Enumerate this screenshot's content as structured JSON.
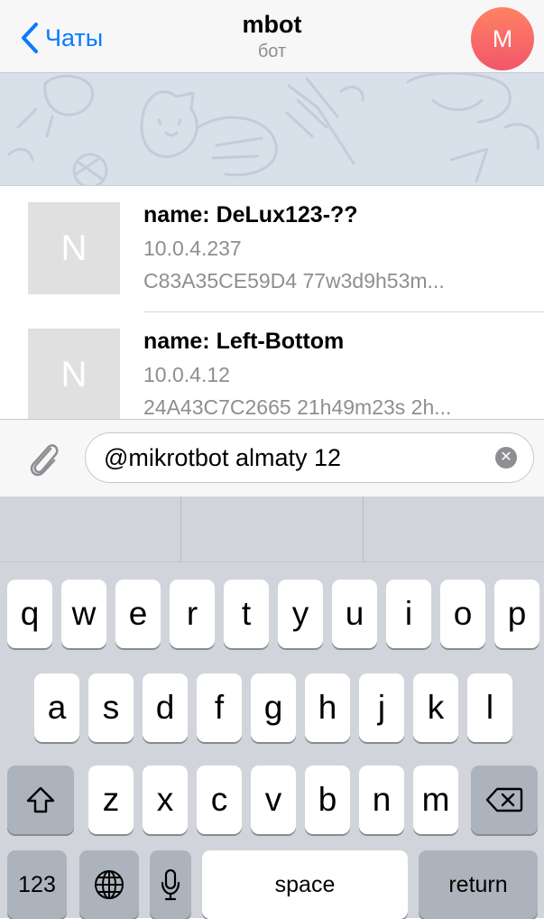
{
  "header": {
    "back_label": "Чаты",
    "title": "mbot",
    "subtitle": "бот",
    "avatar_letter": "M"
  },
  "results": [
    {
      "thumb_letter": "N",
      "title": "name: DeLux123-??",
      "line2": "10.0.4.237",
      "line3": "C83A35CE59D4  77w3d9h53m..."
    },
    {
      "thumb_letter": "N",
      "title": "name: Left-Bottom",
      "line2": "10.0.4.12",
      "line3": "24A43C7C2665 21h49m23s 2h..."
    }
  ],
  "input": {
    "value": "@mikrotbot almaty 12"
  },
  "keyboard": {
    "row1": [
      "q",
      "w",
      "e",
      "r",
      "t",
      "y",
      "u",
      "i",
      "o",
      "p"
    ],
    "row2": [
      "a",
      "s",
      "d",
      "f",
      "g",
      "h",
      "j",
      "k",
      "l"
    ],
    "row3": [
      "z",
      "x",
      "c",
      "v",
      "b",
      "n",
      "m"
    ],
    "numbers_label": "123",
    "space_label": "space",
    "return_label": "return"
  },
  "icons": {
    "back": "chevron-left-icon",
    "attach": "paperclip-icon",
    "clear": "clear-circle-icon",
    "shift": "shift-icon",
    "delete": "delete-icon",
    "globe": "globe-icon",
    "mic": "microphone-icon"
  },
  "colors": {
    "accent": "#0a7aff",
    "avatar_gradient_top": "#ff8263",
    "avatar_gradient_bottom": "#f2566b",
    "keyboard_bg": "#d1d5db"
  }
}
